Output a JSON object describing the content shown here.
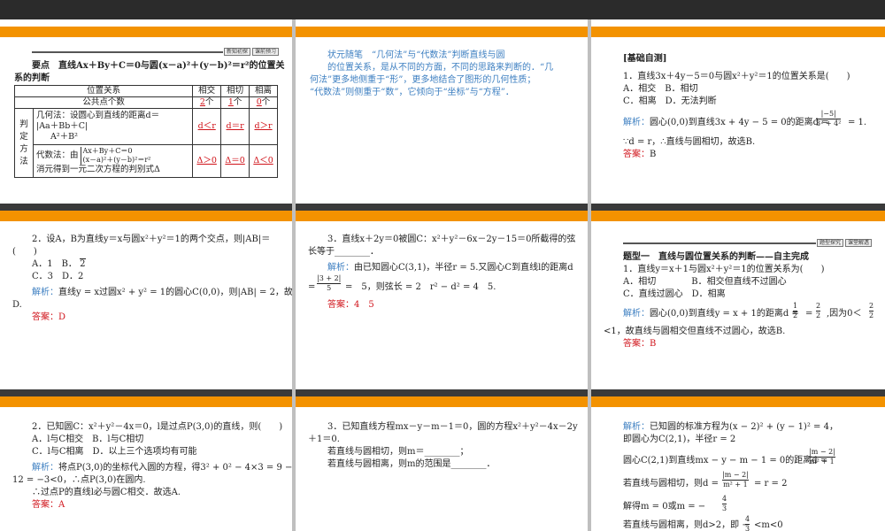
{
  "s1": {
    "banner": [
      "新知初探",
      "课前预习"
    ],
    "title_line1": "要点　直线Ax＋By＋C＝0与圆(x－a)²＋(y－b)²＝r²的位置关",
    "title_line2": "系的判断",
    "table": {
      "header": [
        "位置关系",
        "相交",
        "相切",
        "相离"
      ],
      "common_label": "公共点个数",
      "common_counts": [
        "2",
        "1",
        "0"
      ],
      "unit": "个",
      "method_label": [
        "判",
        "定",
        "方",
        "法"
      ],
      "geo_lines": [
        "几何法：设圆心到直线的距离d＝",
        "|Aa＋Bb＋C|",
        "A²＋B²"
      ],
      "geo_results": [
        "d＜r",
        "d＝r",
        "d＞r"
      ],
      "alg_line1": "代数法：由",
      "alg_sys": [
        "Ax＋By＋C＝0",
        "(x－a)²＋(y－b)²＝r²"
      ],
      "alg_line2": "消元得到一元二次方程的判别式Δ",
      "alg_results": [
        "Δ＞0",
        "Δ＝0",
        "Δ＜0"
      ]
    }
  },
  "s2": {
    "lines": [
      "状元随笔　“几何法”与“代数法”判断直线与圆",
      "的位置关系，是从不同的方面，不同的思路来判断的．“几",
      "何法”更多地侧重于“形”，更多地结合了图形的几何性质；",
      "“代数法”则侧重于“数”，它倾向于“坐标”与“方程”．"
    ]
  },
  "s3": {
    "heading": "[基础自测]",
    "q": "1．直线3x＋4y－5＝0与圆x²＋y²＝1的位置关系是(　　)",
    "opts": [
      "A．相交　B．相切",
      "C．相离　D．无法判断"
    ],
    "sol_label": "解析：",
    "sol1": "圆心(0,0)到直线3x + 4y − 5 = 0的距离d =",
    "frac_num": "|−5|",
    "frac_den": "3² + 4²",
    "sol1_end": "= 1.",
    "sol2": "∵d = r，∴直线与圆相切，故选B.",
    "ans_label": "答案：",
    "ans": "B"
  },
  "s4": {
    "q1": "2．设A，B为直线y＝x与圆x²＋y²＝1的两个交点，则|AB|＝",
    "q2": "(　　)",
    "opts": [
      "A．1　B．",
      "2",
      "C．3　D．2"
    ],
    "sol_label": "解析：",
    "sol1": "直线y = x过圆x² + y² = 1的圆心C(0,0)，则|AB| = 2，故选",
    "sol2": "D.",
    "ans_label": "答案：",
    "ans": "D"
  },
  "s5": {
    "q1": "3．直线x＋2y＝0被圆C：x²＋y²－6x－2y－15＝0所截得的弦",
    "q2": "长等于________．",
    "sol_label": "解析：",
    "sol1": "由已知圆心C(3,1)，半径r = 5.又圆心C到直线l的距离d",
    "sol2a": "=",
    "frac_num": "|3 + 2|",
    "frac_den": "5",
    "sol2b": "=　5，则弦长 = 2　r² − d² = 4　5.",
    "ans_label": "答案：",
    "ans": "4　5"
  },
  "s6": {
    "banner": [
      "题型探究",
      "课堂解透"
    ],
    "heading": "题型一　直线与圆位置关系的判断——自主完成",
    "q": "1．直线y＝x＋1与圆x²＋y²＝1的位置关系为(　　)",
    "opts": [
      "A．相切　　　　B．相交但直线不过圆心",
      "C．直线过圆心　D．相离"
    ],
    "sol_label": "解析：",
    "sol1": "圆心(0,0)到直线y = x + 1的距离d =",
    "frac1_num": "1",
    "frac1_den": "2",
    "sol1_mid": "=",
    "frac2_num": "2",
    "frac2_den": "2",
    "sol1_end": ",因为0＜",
    "frac3_num": "2",
    "frac3_den": "2",
    "sol2": "<1，故直线与圆相交但直线不过圆心，故选B.",
    "ans_label": "答案：",
    "ans": "B"
  },
  "s7": {
    "q1": "2．已知圆C：x²＋y²－4x＝0，l是过点P(3,0)的直线，则(　　)",
    "opts": [
      "A．l与C相交　B．l与C相切",
      "C．l与C相离　D．以上三个选项均有可能"
    ],
    "sol_label": "解析：",
    "sol1": "将点P(3,0)的坐标代入圆的方程，得3² + 0² − 4×3 = 9 −",
    "sol2": "12 = −3<0，∴点P(3,0)在圆内.",
    "sol3": "∴过点P的直线l必与圆C相交．故选A.",
    "ans_label": "答案：",
    "ans": "A"
  },
  "s8": {
    "q1": "3．已知直线方程mx－y－m－1＝0，圆的方程x²＋y²－4x－2y",
    "q2": "＋1＝0.",
    "q3": "若直线与圆相切，则m＝________；",
    "q4": "若直线与圆相离，则m的范围是________．"
  },
  "s9": {
    "sol_label": "解析：",
    "sol1": "已知圆的标准方程为(x − 2)² + (y − 1)² = 4，",
    "sol2": "即圆心为C(2,1)，半径r = 2",
    "sol3": "圆心C(2,1)到直线mx − y − m − 1 = 0的距离d =",
    "frac1_num": "|m − 2|",
    "frac1_den": "m² + 1",
    "sol4": "若直线与圆相切，则d =",
    "frac2_num": "|m − 2|",
    "frac2_den": "m² + 1",
    "sol4_end": "= r = 2",
    "sol5": "解得m = 0或m = −",
    "frac3_num": "4",
    "frac3_den": "3",
    "sol6": "若直线与圆相离，则d>2，即 −",
    "frac4_num": "4",
    "frac4_den": "3",
    "sol6_end": "<m<0"
  }
}
